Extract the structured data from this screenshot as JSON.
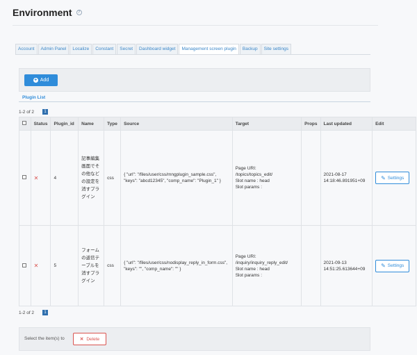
{
  "page": {
    "title": "Environment"
  },
  "tabs": [
    {
      "label": "Account",
      "active": false
    },
    {
      "label": "Admin Panel",
      "active": false
    },
    {
      "label": "Localize",
      "active": false
    },
    {
      "label": "Constant",
      "active": false
    },
    {
      "label": "Secret",
      "active": false
    },
    {
      "label": "Dashboard widget",
      "active": false
    },
    {
      "label": "Management screen plugin",
      "active": true
    },
    {
      "label": "Backup",
      "active": false
    },
    {
      "label": "Site settings",
      "active": false
    }
  ],
  "actions": {
    "add_label": "Add",
    "plugin_list_label": "Plugin List"
  },
  "pagination": {
    "summary": "1-2 of 2",
    "current_page": "1"
  },
  "table": {
    "headers": {
      "status": "Status",
      "plugin_id": "Plugin_id",
      "name": "Name",
      "type": "Type",
      "source": "Source",
      "target": "Target",
      "props": "Props",
      "last_updated": "Last updated",
      "edit": "Edit"
    },
    "rows": [
      {
        "plugin_id": "4",
        "name": "記事編集画面でその他などの設定を消すプラグイン",
        "type": "css",
        "source": "{ \"url\": \"/files/user/css/mngplugin_sample.css\", \"keys\": \"abcd12345\", \"comp_name\": \"Plugin_1\" }",
        "target_line1": "Page URI:",
        "target_line2": "/topics/topics_edit/",
        "target_line3": "Slot name : head",
        "target_line4": "Slot params :",
        "props": "",
        "updated_line1": "2021-08-17",
        "updated_line2": "14:18:46.891951+09",
        "edit_label": "Settings"
      },
      {
        "plugin_id": "5",
        "name": "フォームの返信テーブルを消すプラグイン",
        "type": "css",
        "source": "{ \"url\": \"/files/user/css/nodisplay_reply_in_form.css\", \"keys\": \"\", \"comp_name\": \"\" }",
        "target_line1": "Page URI:",
        "target_line2": "/inquiry/inquiry_reply_edit/",
        "target_line3": "Slot name : head",
        "target_line4": "Slot params :",
        "props": "",
        "updated_line1": "2021-09-13",
        "updated_line2": "14:51:25.613644+09",
        "edit_label": "Settings"
      }
    ]
  },
  "bulk": {
    "select_label": "Select the item(s) to",
    "delete_label": "Delete"
  },
  "colors": {
    "accent": "#2f8cda",
    "danger": "#d9534f"
  },
  "icons": {
    "help": "help-circle-icon",
    "add": "plus-circle-icon",
    "status": "x-icon",
    "settings": "pencil-icon",
    "delete": "x-icon"
  }
}
